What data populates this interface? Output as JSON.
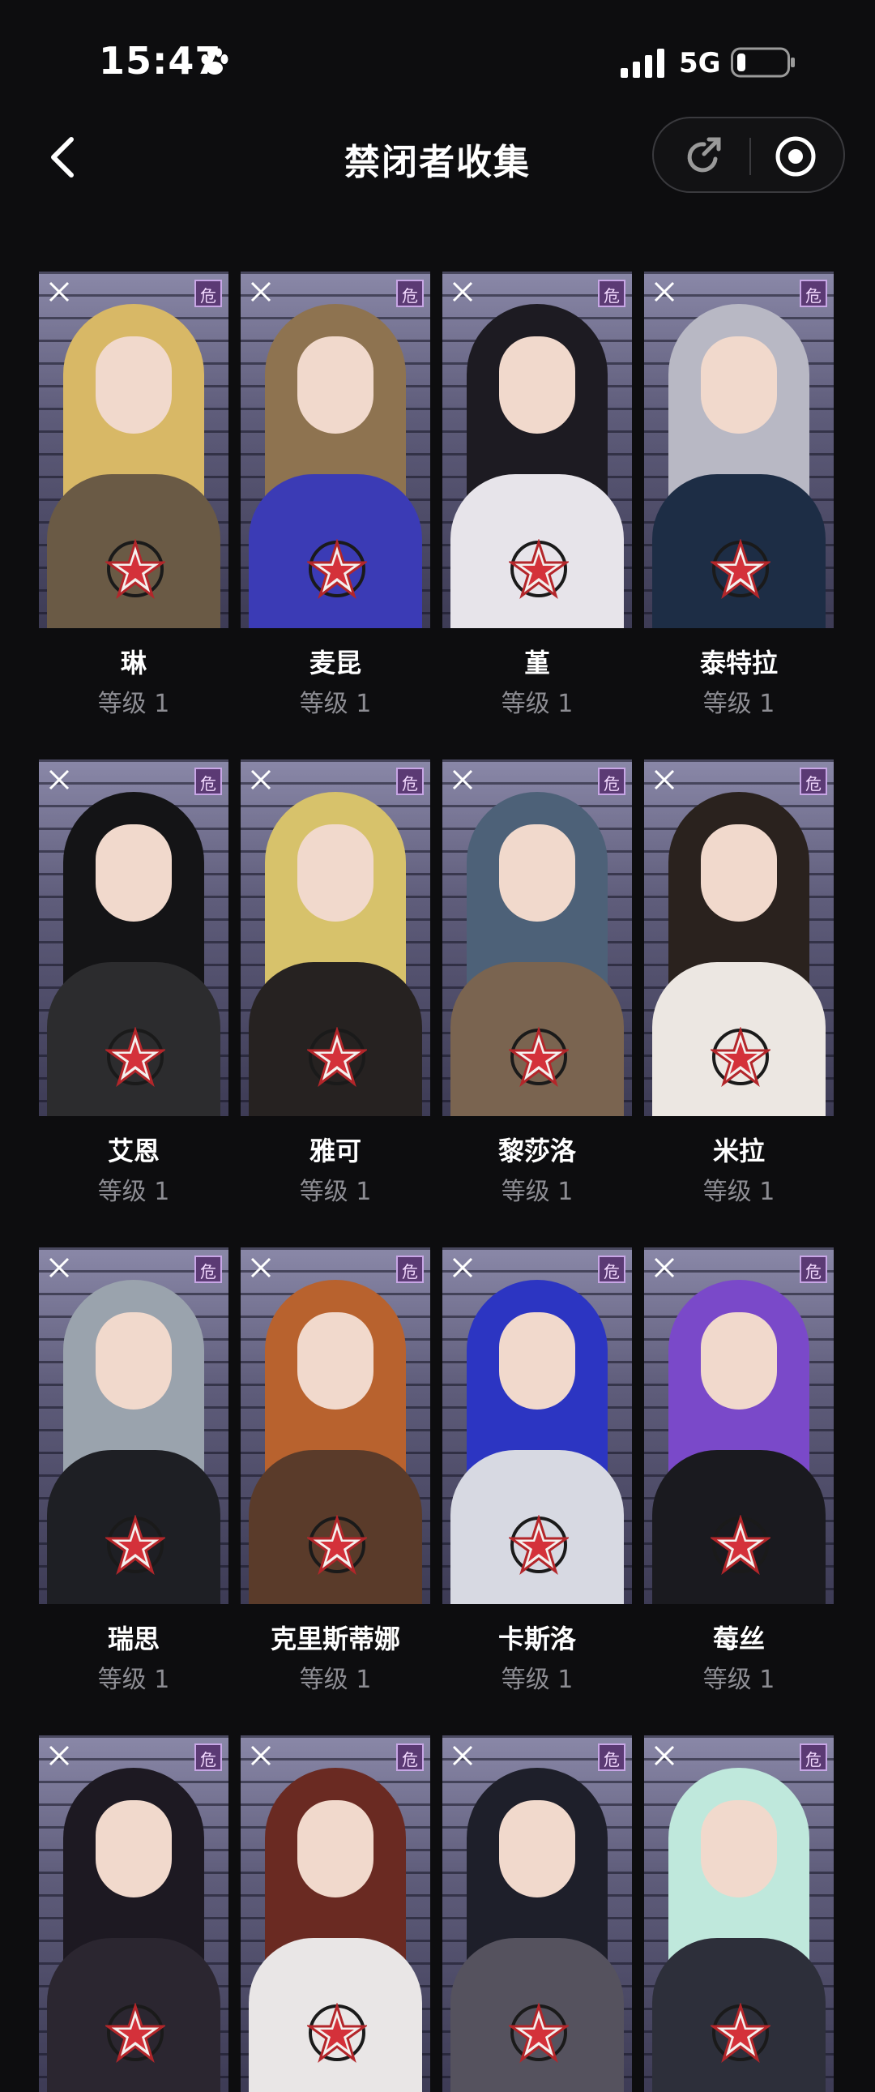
{
  "status_bar": {
    "time": "15:47",
    "network": "5G",
    "icons": [
      "paw-icon",
      "signal-icon",
      "battery-icon"
    ]
  },
  "nav": {
    "title": "禁闭者收集",
    "back_icon": "chevron-left-icon",
    "capsule_icons": [
      "share-icon",
      "target-icon"
    ]
  },
  "level_prefix": "等级",
  "cards": [
    {
      "name": "琳",
      "level": "等级 1",
      "hair": "#d8b866",
      "outfit": "#6a5a45"
    },
    {
      "name": "麦昆",
      "level": "等级 1",
      "hair": "#8e7350",
      "outfit": "#3b3bb5"
    },
    {
      "name": "堇",
      "level": "等级 1",
      "hair": "#1d1b22",
      "outfit": "#e7e4ea"
    },
    {
      "name": "泰特拉",
      "level": "等级 1",
      "hair": "#b8b8c4",
      "outfit": "#1d2d45"
    },
    {
      "name": "艾恩",
      "level": "等级 1",
      "hair": "#141416",
      "outfit": "#2c2c2e"
    },
    {
      "name": "雅可",
      "level": "等级 1",
      "hair": "#d7c26b",
      "outfit": "#262221"
    },
    {
      "name": "黎莎洛",
      "level": "等级 1",
      "hair": "#4d6178",
      "outfit": "#7a6450"
    },
    {
      "name": "米拉",
      "level": "等级 1",
      "hair": "#2a221e",
      "outfit": "#ece7e2"
    },
    {
      "name": "瑞思",
      "level": "等级 1",
      "hair": "#9aa3ad",
      "outfit": "#1e1f24"
    },
    {
      "name": "克里斯蒂娜",
      "level": "等级 1",
      "hair": "#b8622e",
      "outfit": "#5a3b2a"
    },
    {
      "name": "卡斯洛",
      "level": "等级 1",
      "hair": "#2c35c2",
      "outfit": "#d7d9e2"
    },
    {
      "name": "莓丝",
      "level": "等级 1",
      "hair": "#7a49c9",
      "outfit": "#1a1a1f"
    },
    {
      "name": "",
      "level": "",
      "hair": "#1d1922",
      "outfit": "#2b2630"
    },
    {
      "name": "",
      "level": "",
      "hair": "#6a2a22",
      "outfit": "#e9e6e6"
    },
    {
      "name": "",
      "level": "",
      "hair": "#1e1f2a",
      "outfit": "#55525e"
    },
    {
      "name": "",
      "level": "",
      "hair": "#bfe8dc",
      "outfit": "#2d2f3a"
    }
  ]
}
